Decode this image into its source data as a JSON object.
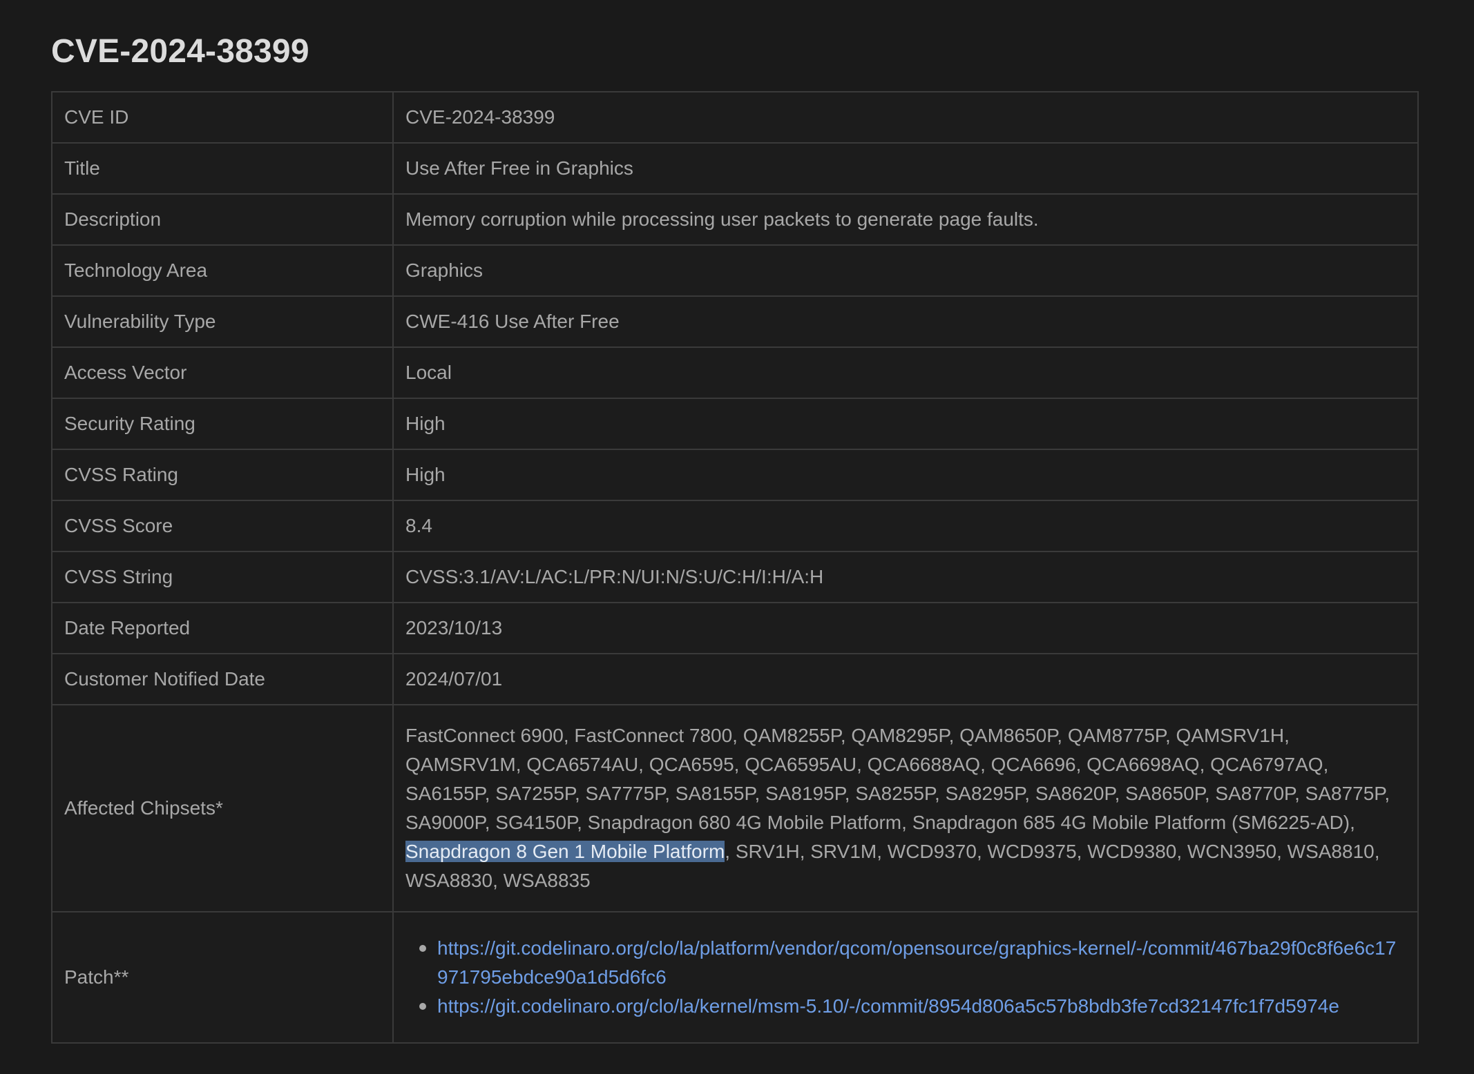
{
  "page": {
    "title": "CVE-2024-38399"
  },
  "rows": [
    {
      "label": "CVE ID",
      "value": "CVE-2024-38399"
    },
    {
      "label": "Title",
      "value": "Use After Free in Graphics"
    },
    {
      "label": "Description",
      "value": "Memory corruption while processing user packets to generate page faults."
    },
    {
      "label": "Technology Area",
      "value": "Graphics"
    },
    {
      "label": "Vulnerability Type",
      "value": "CWE-416 Use After Free"
    },
    {
      "label": "Access Vector",
      "value": "Local"
    },
    {
      "label": "Security Rating",
      "value": "High"
    },
    {
      "label": "CVSS Rating",
      "value": "High"
    },
    {
      "label": "CVSS Score",
      "value": "8.4"
    },
    {
      "label": "CVSS String",
      "value": "CVSS:3.1/AV:L/AC:L/PR:N/UI:N/S:U/C:H/I:H/A:H"
    },
    {
      "label": "Date Reported",
      "value": "2023/10/13"
    },
    {
      "label": "Customer Notified Date",
      "value": "2024/07/01"
    }
  ],
  "chipsets": {
    "label": "Affected Chipsets*",
    "text_before": "FastConnect 6900, FastConnect 7800, QAM8255P, QAM8295P, QAM8650P, QAM8775P, QAMSRV1H, QAMSRV1M, QCA6574AU, QCA6595, QCA6595AU, QCA6688AQ, QCA6696, QCA6698AQ, QCA6797AQ, SA6155P, SA7255P, SA7775P, SA8155P, SA8195P, SA8255P, SA8295P, SA8620P, SA8650P, SA8770P, SA8775P, SA9000P, SG4150P, Snapdragon 680 4G Mobile Platform, Snapdragon 685 4G Mobile Platform (SM6225-AD), ",
    "selected_text": "Snapdragon 8 Gen 1 Mobile Platform",
    "text_after": ", SRV1H, SRV1M, WCD9370, WCD9375, WCD9380, WCN3950, WSA8810, WSA8830, WSA8835"
  },
  "patch": {
    "label": "Patch**",
    "links": [
      "https://git.codelinaro.org/clo/la/platform/vendor/qcom/opensource/graphics-kernel/-/commit/467ba29f0c8f6e6c17971795ebdce90a1d5d6fc6",
      "https://git.codelinaro.org/clo/la/kernel/msm-5.10/-/commit/8954d806a5c57b8bdb3fe7cd32147fc1f7d5974e"
    ]
  },
  "colors": {
    "background": "#1a1a1a",
    "text": "#a8a8a8",
    "title": "#dcdcdc",
    "border": "#3a3a3a",
    "link": "#6f9ee6",
    "selection": "#4a6a92"
  }
}
